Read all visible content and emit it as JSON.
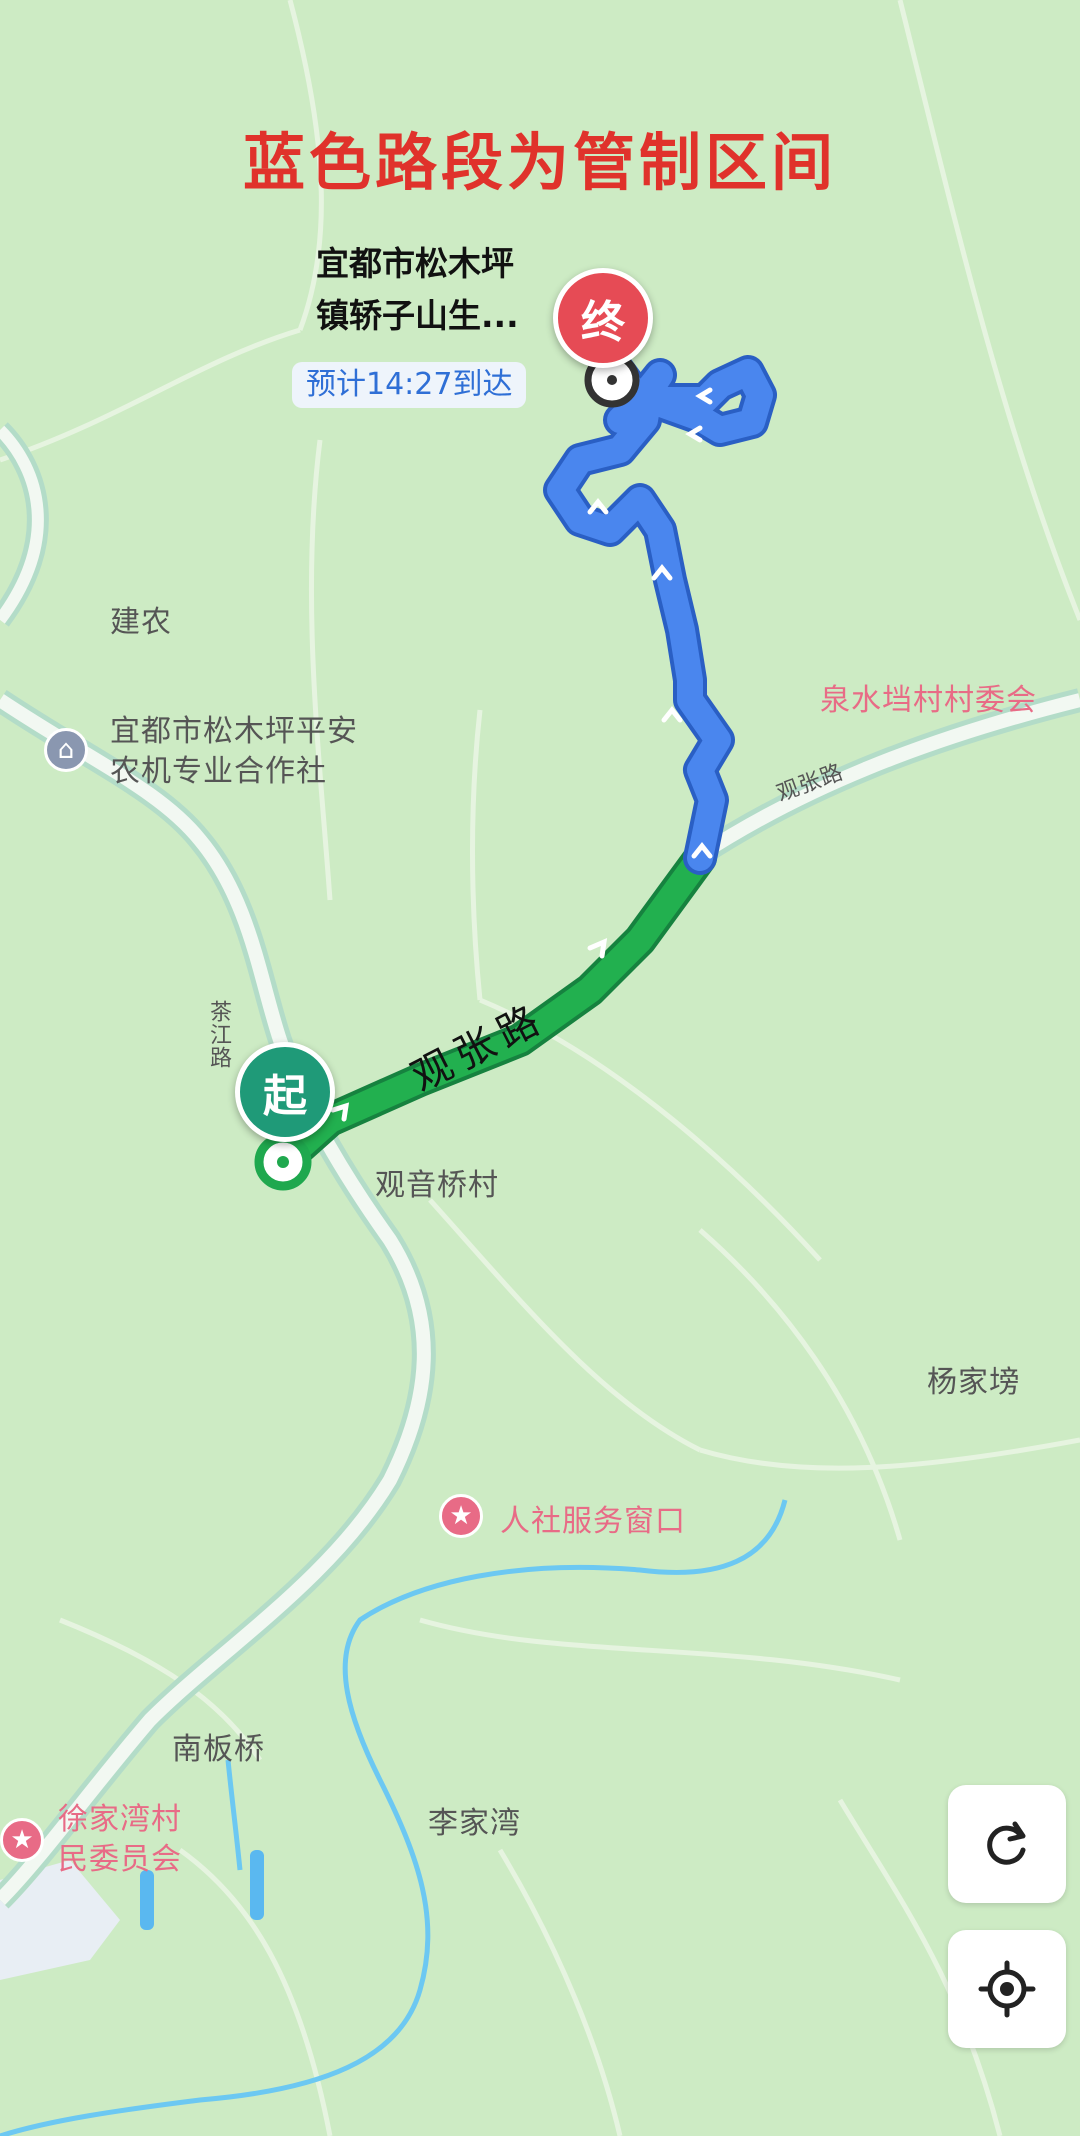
{
  "banner": "蓝色路段为管制区间",
  "destination": {
    "name_line1": "宜都市松木坪",
    "name_line2": "镇轿子山生...",
    "eta": "预计14:27到达",
    "pin_label": "终"
  },
  "start": {
    "pin_label": "起"
  },
  "road_labels": {
    "guanzhang_main": "观张路",
    "guanzhang_small": "观张路",
    "chajiang": "茶江路"
  },
  "places": {
    "jiannong": "建农",
    "coop_line1": "宜都市松木坪平安",
    "coop_line2": "农机专业合作社",
    "quanshui": "泉水垱村村委会",
    "guanyinqiao": "观音桥村",
    "yangjia": "杨家塝",
    "renshe": "人社服务窗口",
    "nanbanqiao": "南板桥",
    "xujiawan_line1": "徐家湾村",
    "xujiawan_line2": "民委员会",
    "lijiawan": "李家湾"
  },
  "colors": {
    "restricted_route": "#3f7be8",
    "normal_route": "#1fa84e",
    "banner_text": "#e0322b",
    "map_bg": "#cdebc4"
  },
  "icons": {
    "refresh": "refresh-icon",
    "locate": "locate-icon"
  }
}
